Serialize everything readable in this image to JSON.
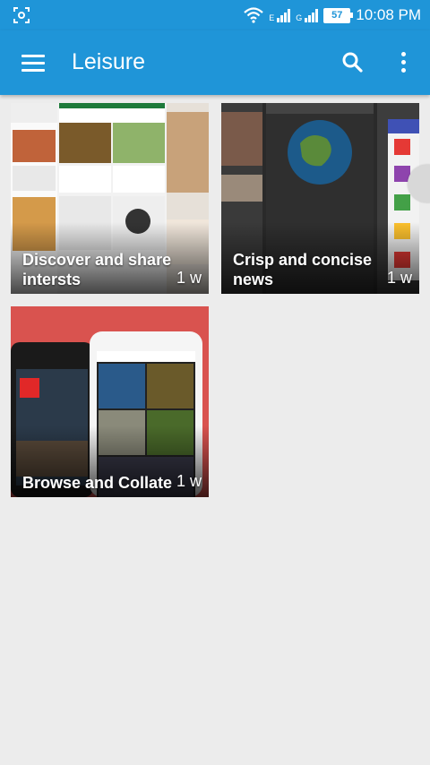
{
  "status_bar": {
    "time": "10:08 PM",
    "battery": "57",
    "network_1": "E",
    "network_2": "G"
  },
  "app_bar": {
    "title": "Leisure",
    "menu_icon": "hamburger-menu-icon",
    "search_icon": "search-icon",
    "more_icon": "more-vert-icon"
  },
  "cards": [
    {
      "title": "Discover and share intersts",
      "time": "1 w"
    },
    {
      "title": "Crisp and concise news",
      "time": "1 w"
    },
    {
      "title": "Browse and Collate",
      "time": "1 w"
    }
  ],
  "colors": {
    "primary": "#1f95d8",
    "background": "#ececec"
  }
}
